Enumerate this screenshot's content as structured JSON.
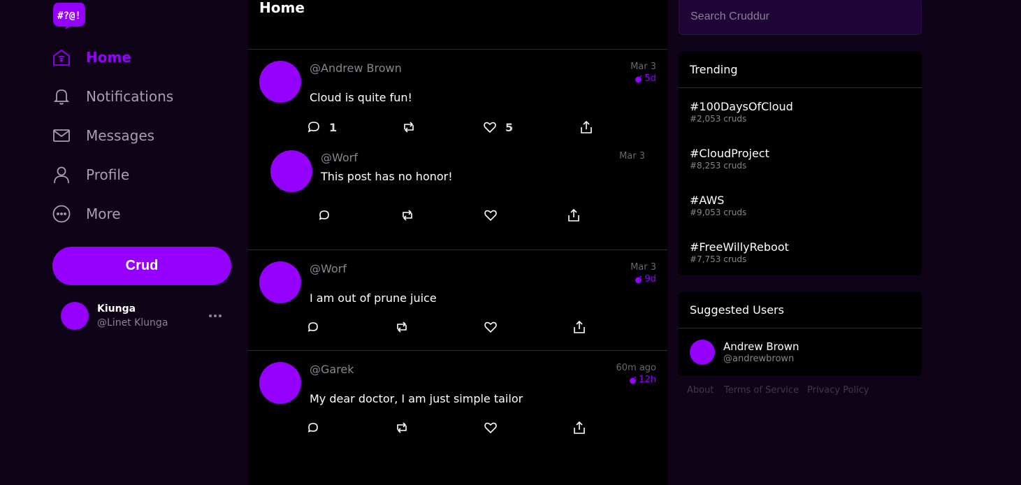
{
  "colors": {
    "accent": "#9500ff",
    "background": "#0e0317",
    "feed_bg": "#000000",
    "search_bg": "#1e0535"
  },
  "logo": {
    "text": "#?@!"
  },
  "nav": {
    "items": [
      {
        "label": "Home",
        "icon": "home-icon",
        "active": true
      },
      {
        "label": "Notifications",
        "icon": "bell-icon",
        "active": false
      },
      {
        "label": "Messages",
        "icon": "envelope-icon",
        "active": false
      },
      {
        "label": "Profile",
        "icon": "user-icon",
        "active": false
      },
      {
        "label": "More",
        "icon": "more-circle-icon",
        "active": false
      }
    ],
    "crud_button": "Crud",
    "profile": {
      "display_name": "Kiunga",
      "handle": "@Linet Klunga"
    }
  },
  "feed": {
    "title": "Home",
    "posts": [
      {
        "handle": "@Andrew Brown",
        "message": "Cloud is quite fun!",
        "date": "Mar 3",
        "expires": "5d",
        "replies": "1",
        "likes": "5"
      },
      {
        "handle": "@Worf",
        "message": "This post has no honor!",
        "date": "Mar 3"
      },
      {
        "handle": "@Worf",
        "message": "I am out of prune juice",
        "date": "Mar 3",
        "expires": "9d"
      },
      {
        "handle": "@Garek",
        "message": "My dear doctor, I am just simple tailor",
        "date": "60m ago",
        "expires": "12h"
      }
    ]
  },
  "search": {
    "placeholder": "Search Cruddur"
  },
  "trending": {
    "title": "Trending",
    "items": [
      {
        "tag": "#100DaysOfCloud",
        "count": "#2,053 cruds"
      },
      {
        "tag": "#CloudProject",
        "count": "#8,253 cruds"
      },
      {
        "tag": "#AWS",
        "count": "#9,053 cruds"
      },
      {
        "tag": "#FreeWillyReboot",
        "count": "#7,753 cruds"
      }
    ]
  },
  "suggested": {
    "title": "Suggested Users",
    "users": [
      {
        "name": "Andrew Brown",
        "handle": "@andrewbrown"
      }
    ]
  },
  "footer": {
    "links": [
      "About",
      "Terms of Service",
      "Privacy Policy"
    ]
  }
}
